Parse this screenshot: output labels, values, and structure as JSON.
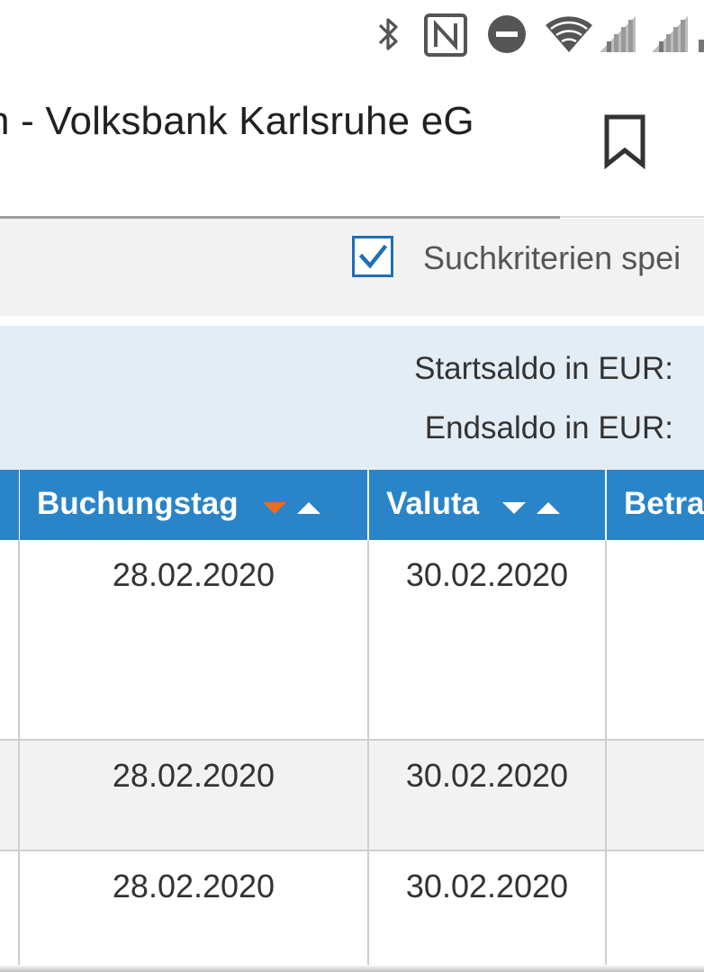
{
  "status_bar": {
    "icons": [
      "bluetooth-icon",
      "nfc-icon",
      "do-not-disturb-icon",
      "wifi-icon",
      "signal-icon",
      "signal-icon-2"
    ]
  },
  "header": {
    "title": "n - Volksbank Karlsruhe eG",
    "bookmark_icon": "bookmark-icon"
  },
  "search_options": {
    "save_criteria_checked": true,
    "save_criteria_label": "Suchkriterien spei"
  },
  "balance": {
    "start_label": "Startsaldo in EUR:",
    "end_label": "Endsaldo in EUR:"
  },
  "table": {
    "columns": [
      {
        "label": "Buchungstag",
        "sort": "descending-active"
      },
      {
        "label": "Valuta",
        "sort": "none"
      },
      {
        "label": "Betra"
      }
    ],
    "rows": [
      {
        "buchungstag": "28.02.2020",
        "valuta": "30.02.2020"
      },
      {
        "buchungstag": "28.02.2020",
        "valuta": "30.02.2020"
      },
      {
        "buchungstag": "28.02.2020",
        "valuta": "30.02.2020"
      }
    ]
  },
  "colors": {
    "header_blue": "#2a84c8",
    "balance_bg": "#e3edf6",
    "sort_active": "#ef6c1a",
    "checkbox_blue": "#1f6fb5"
  }
}
